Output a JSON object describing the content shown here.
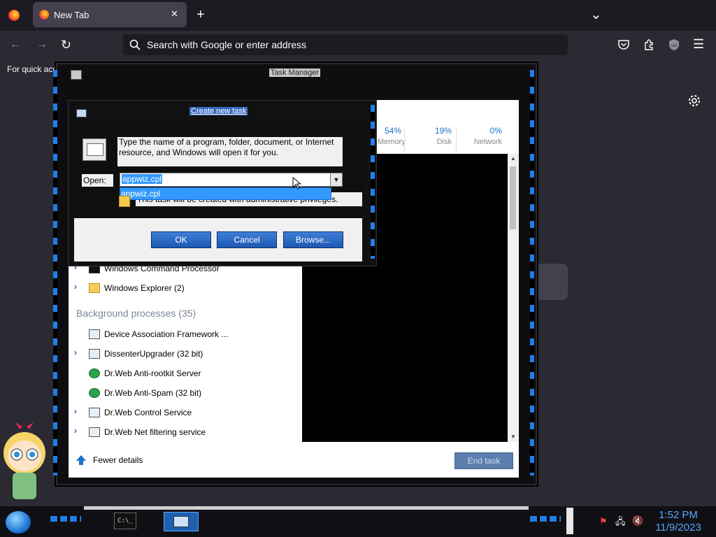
{
  "browser": {
    "tab_title": "New Tab",
    "new_tab_glyph": "+",
    "close_glyph": "✕",
    "list_tabs_glyph": "⌄",
    "url_placeholder": "Search with Google or enter address",
    "bookmarks_text": "For quick acc"
  },
  "task_manager": {
    "title": "Task Manager",
    "columns": [
      {
        "percent": "54%",
        "label": "Memory"
      },
      {
        "percent": "19%",
        "label": "Disk"
      },
      {
        "percent": "0%",
        "label": "Network"
      }
    ],
    "apps": [
      {
        "name": "Windows Command Processor",
        "icon": "cmd-icon"
      },
      {
        "name": "Windows Explorer (2)",
        "icon": "folder-icon"
      }
    ],
    "background_header": "Background processes (35)",
    "background": [
      {
        "name": "Device Association Framework ...",
        "icon": "service-icon",
        "expand": false
      },
      {
        "name": "DissenterUpgrader (32 bit)",
        "icon": "service-icon",
        "expand": true
      },
      {
        "name": "Dr.Web Anti-rootkit Server",
        "icon": "drweb-icon",
        "expand": false
      },
      {
        "name": "Dr.Web Anti-Spam (32 bit)",
        "icon": "drweb-icon",
        "expand": false
      },
      {
        "name": "Dr.Web Control Service",
        "icon": "service-icon",
        "expand": true
      },
      {
        "name": "Dr.Web Net filtering service",
        "icon": "service-icon",
        "expand": true
      }
    ],
    "fewer_details": "Fewer details",
    "end_task": "End task"
  },
  "run_dialog": {
    "title": "Create new task",
    "description": "Type the name of a program, folder, document, or Internet resource, and Windows will open it for you.",
    "open_label": "Open:",
    "open_value": "appwiz.cpl",
    "dropdown_item": "appwiz.cpl",
    "admin_note": "This task will be created with administrative privileges.",
    "ok": "OK",
    "cancel": "Cancel",
    "browse": "Browse..."
  },
  "taskbar": {
    "time": "1:52 PM",
    "date": "11/9/2023"
  }
}
